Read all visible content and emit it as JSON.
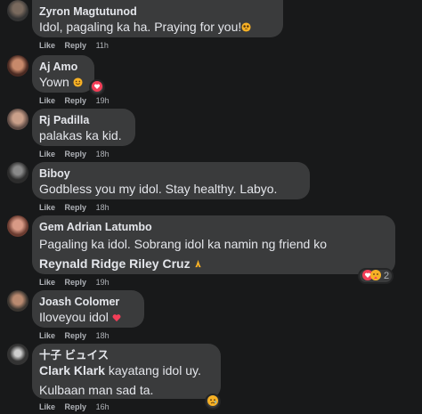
{
  "colors": {
    "bubble": "#3a3b3c",
    "page": "#18191a",
    "heart": "#f33e58",
    "haha": "#f7b125",
    "meta": "#b0b3b8"
  },
  "actions": {
    "like": "Like",
    "reply": "Reply"
  },
  "comments": [
    {
      "author": "Zyron Magtutunod",
      "text": "Idol, pagaling ka ha. Praying for you!",
      "emoji": "pleading-face-emoji",
      "time": "11h"
    },
    {
      "author": "Aj Amo",
      "text": "Yown",
      "emoji": "grinning-face-emoji",
      "reaction": "heart-reaction",
      "time": "19h"
    },
    {
      "author": "Rj Padilla",
      "text": "palakas ka kid.",
      "time": "18h"
    },
    {
      "author": "Biboy",
      "text": "Godbless you my idol. Stay healthy. Labyo.",
      "time": "18h"
    },
    {
      "author": "Gem Adrian Latumbo",
      "text": "Pagaling ka idol. Sobrang idol ka namin ng friend ko",
      "mention": "Reynald Ridge Riley Cruz",
      "emoji": "folded-hands-emoji",
      "reactions": [
        "heart-reaction",
        "care-reaction"
      ],
      "reaction_count": "2",
      "time": "19h"
    },
    {
      "author": "Joash Colomer",
      "text": "Iloveyou idol",
      "emoji": "red-heart-emoji",
      "time": "18h"
    },
    {
      "author": "十子 ビュイス",
      "mention": "Clark Klark",
      "text": "kayatang idol uy.",
      "text2": "Kulbaan man sad ta.",
      "reaction": "sad-reaction",
      "time": "16h"
    }
  ]
}
